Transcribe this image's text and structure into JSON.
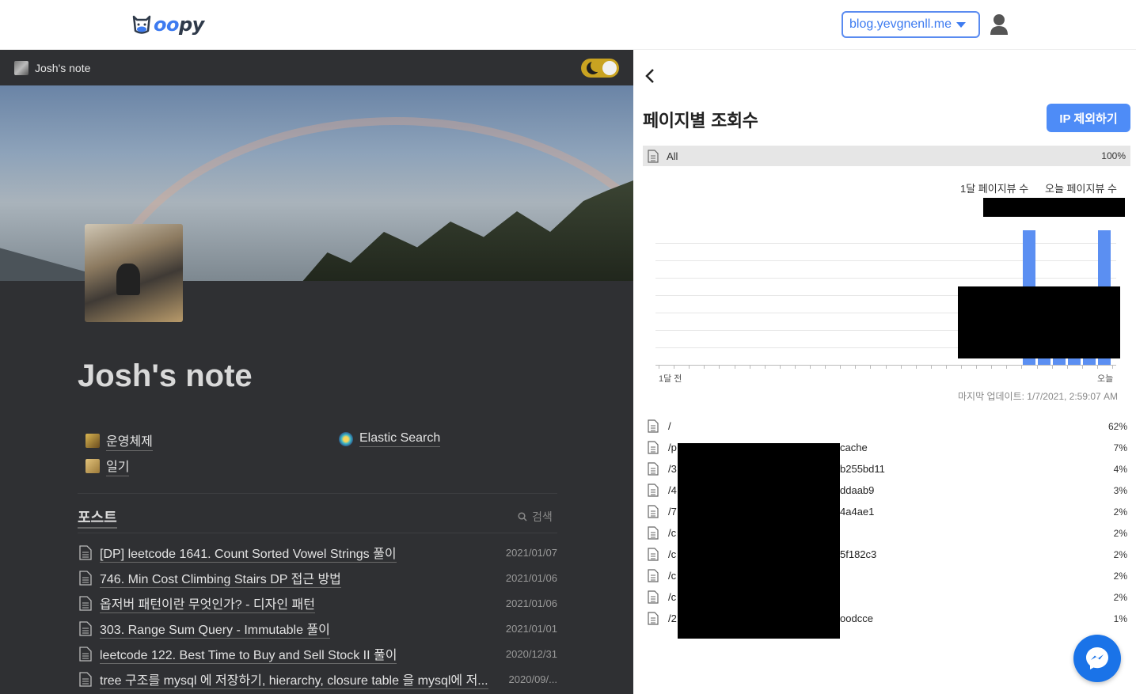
{
  "topbar": {
    "logo_prefix": "",
    "logo_oo": "oo",
    "logo_suffix": "py",
    "domain": "blog.yevgnenll.me"
  },
  "left": {
    "header_title": "Josh's note",
    "page_title": "Josh's note",
    "links": [
      {
        "label": "운영체제",
        "icon": "os-icon"
      },
      {
        "label": "일기",
        "icon": "diary-icon"
      },
      {
        "label": "Elastic Search",
        "icon": "elastic-icon"
      }
    ],
    "posts_title": "포스트",
    "search_label": "검색",
    "posts": [
      {
        "title": "[DP] leetcode 1641. Count Sorted Vowel Strings 풀이",
        "date": "2021/01/07"
      },
      {
        "title": "746. Min Cost Climbing Stairs DP 접근 방법",
        "date": "2021/01/06"
      },
      {
        "title": "옵저버 패턴이란 무엇인가? - 디자인 패턴",
        "date": "2021/01/06"
      },
      {
        "title": "303. Range Sum Query - Immutable 풀이",
        "date": "2021/01/01"
      },
      {
        "title": "leetcode 122. Best Time to Buy and Sell Stock II 풀이",
        "date": "2020/12/31"
      },
      {
        "title": "tree 구조를 mysql 에 저장하기, hierarchy, closure table 을 mysql에 저...",
        "date": "2020/09/..."
      }
    ]
  },
  "right": {
    "title": "페이지별 조회수",
    "ip_button": "IP 제외하기",
    "all_label": "All",
    "all_pct": "100%",
    "legend_month": "1달 페이지뷰 수",
    "legend_today": "오늘 페이지뷰 수",
    "x_start": "1달 전",
    "x_end": "오늘",
    "updated": "마지막 업데이트: 1/7/2021, 2:59:07 AM",
    "paths": [
      {
        "prefix": "/",
        "suffix": "",
        "pct": "62%"
      },
      {
        "prefix": "/p",
        "suffix": "cache",
        "pct": "7%"
      },
      {
        "prefix": "/3",
        "suffix": "b255bd11",
        "pct": "4%"
      },
      {
        "prefix": "/4",
        "suffix": "ddaab9",
        "pct": "3%"
      },
      {
        "prefix": "/7",
        "suffix": "4a4ae1",
        "pct": "2%"
      },
      {
        "prefix": "/c",
        "suffix": "",
        "pct": "2%"
      },
      {
        "prefix": "/c",
        "suffix": "5f182c3",
        "pct": "2%"
      },
      {
        "prefix": "/c",
        "suffix": "",
        "pct": "2%"
      },
      {
        "prefix": "/c",
        "suffix": "",
        "pct": "2%"
      },
      {
        "prefix": "/2",
        "suffix": "oodcce",
        "pct": "1%"
      }
    ]
  },
  "colors": {
    "accent": "#4e8cf7",
    "dark_bg": "#2f3033",
    "bar": "#5b8ff2",
    "toggle": "#c9a321",
    "messenger": "#1a73e8"
  }
}
